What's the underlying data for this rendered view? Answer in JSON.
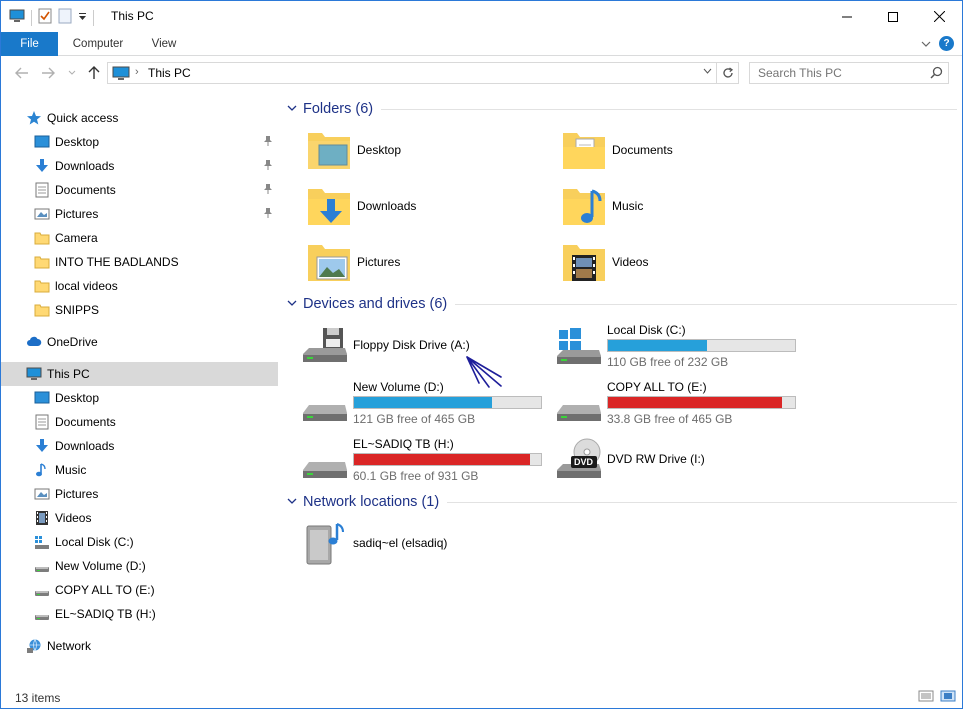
{
  "window": {
    "title": "This PC"
  },
  "ribbon": {
    "tabs": [
      {
        "label": "File"
      },
      {
        "label": "Computer"
      },
      {
        "label": "View"
      }
    ],
    "help_label": "?"
  },
  "address": {
    "crumb": "This PC",
    "search_placeholder": "Search This PC"
  },
  "sidebar": {
    "quick_access_label": "Quick access",
    "quick_access": [
      {
        "label": "Desktop",
        "pinned": true
      },
      {
        "label": "Downloads",
        "pinned": true
      },
      {
        "label": "Documents",
        "pinned": true
      },
      {
        "label": "Pictures",
        "pinned": true
      },
      {
        "label": "Camera",
        "pinned": false
      },
      {
        "label": "INTO THE BADLANDS",
        "pinned": false
      },
      {
        "label": "local videos",
        "pinned": false
      },
      {
        "label": "SNIPPS",
        "pinned": false
      }
    ],
    "onedrive_label": "OneDrive",
    "this_pc_label": "This PC",
    "this_pc_items": [
      {
        "label": "Desktop"
      },
      {
        "label": "Documents"
      },
      {
        "label": "Downloads"
      },
      {
        "label": "Music"
      },
      {
        "label": "Pictures"
      },
      {
        "label": "Videos"
      },
      {
        "label": "Local Disk (C:)"
      },
      {
        "label": "New Volume (D:)"
      },
      {
        "label": "COPY ALL TO (E:)"
      },
      {
        "label": "EL~SADIQ TB (H:)"
      }
    ],
    "network_label": "Network"
  },
  "content": {
    "folders_title": "Folders (6)",
    "folders": [
      {
        "label": "Desktop",
        "icon": "desktop-folder-icon"
      },
      {
        "label": "Documents",
        "icon": "documents-folder-icon"
      },
      {
        "label": "Downloads",
        "icon": "downloads-folder-icon"
      },
      {
        "label": "Music",
        "icon": "music-folder-icon"
      },
      {
        "label": "Pictures",
        "icon": "pictures-folder-icon"
      },
      {
        "label": "Videos",
        "icon": "videos-folder-icon"
      }
    ],
    "devices_title": "Devices and drives (6)",
    "drives": [
      {
        "label": "Floppy Disk Drive (A:)",
        "free": "",
        "used_fraction": null,
        "icon": "floppy-drive-icon"
      },
      {
        "label": "Local Disk (C:)",
        "free": "110 GB free of 232 GB",
        "used_fraction": 0.53,
        "bar_color": "#26a0da",
        "icon": "windows-drive-icon"
      },
      {
        "label": "New Volume (D:)",
        "free": "121 GB free of 465 GB",
        "used_fraction": 0.74,
        "bar_color": "#26a0da",
        "icon": "hard-drive-icon"
      },
      {
        "label": "COPY ALL TO (E:)",
        "free": "33.8 GB free of 465 GB",
        "used_fraction": 0.93,
        "bar_color": "#da2626",
        "icon": "hard-drive-icon"
      },
      {
        "label": "EL~SADIQ TB (H:)",
        "free": "60.1 GB free of 931 GB",
        "used_fraction": 0.94,
        "bar_color": "#da2626",
        "icon": "hard-drive-icon"
      },
      {
        "label": "DVD RW Drive (I:)",
        "free": "",
        "used_fraction": null,
        "icon": "dvd-drive-icon",
        "badge": "DVD"
      }
    ],
    "network_title": "Network locations (1)",
    "network": [
      {
        "label": "sadiq~el (elsadiq)",
        "icon": "media-server-icon"
      }
    ]
  },
  "status": {
    "count": "13 items"
  }
}
